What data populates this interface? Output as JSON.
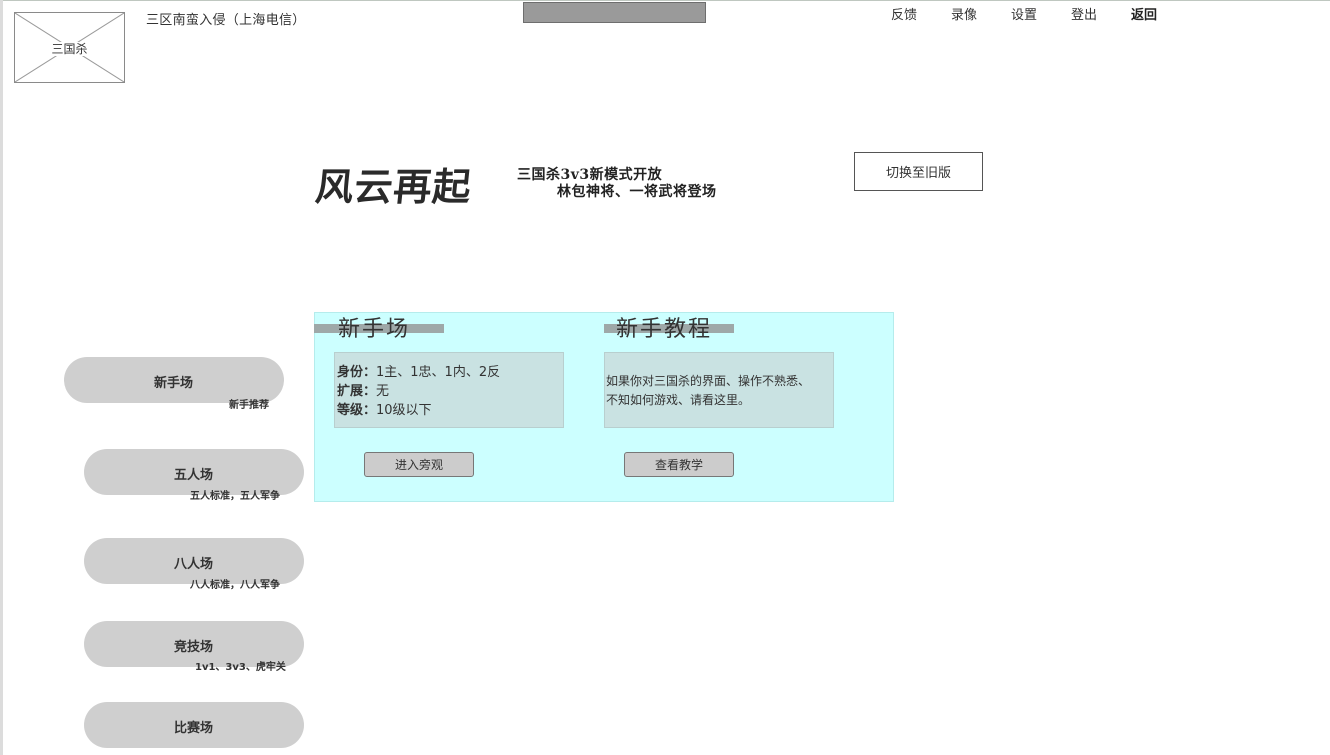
{
  "header": {
    "logo_text": "三国杀",
    "server": "三区南蛮入侵（上海电信）",
    "nav": [
      "反馈",
      "录像",
      "设置",
      "登出",
      "返回"
    ]
  },
  "banner": {
    "title": "风云再起",
    "line1": "三国杀3v3新模式开放",
    "line2": "林包神将、一将武将登场",
    "switch_label": "切换至旧版"
  },
  "menu": [
    {
      "title": "新手场",
      "subtitle": "新手推荐"
    },
    {
      "title": "五人场",
      "subtitle": "五人标准，五人军争"
    },
    {
      "title": "八人场",
      "subtitle": "八人标准，八人军争"
    },
    {
      "title": "竞技场",
      "subtitle": "1v1、3v3、虎牢关"
    },
    {
      "title": "比赛场",
      "subtitle": ""
    }
  ],
  "panel": {
    "left": {
      "title": "新手场",
      "identity_label": "身份：",
      "identity_value": "1主、1忠、1内、2反",
      "expansion_label": "扩展：",
      "expansion_value": "无",
      "level_label": "等级：",
      "level_value": "10级以下",
      "button": "进入旁观"
    },
    "right": {
      "title": "新手教程",
      "text_line1": "如果你对三国杀的界面、操作不熟悉、",
      "text_line2": "不知如何游戏、请看这里。",
      "button": "查看教学"
    }
  },
  "colors": {
    "panel_bg": "#ccffff",
    "pill_bg": "#cfcfcf",
    "info_bg": "#c9e2e2"
  }
}
